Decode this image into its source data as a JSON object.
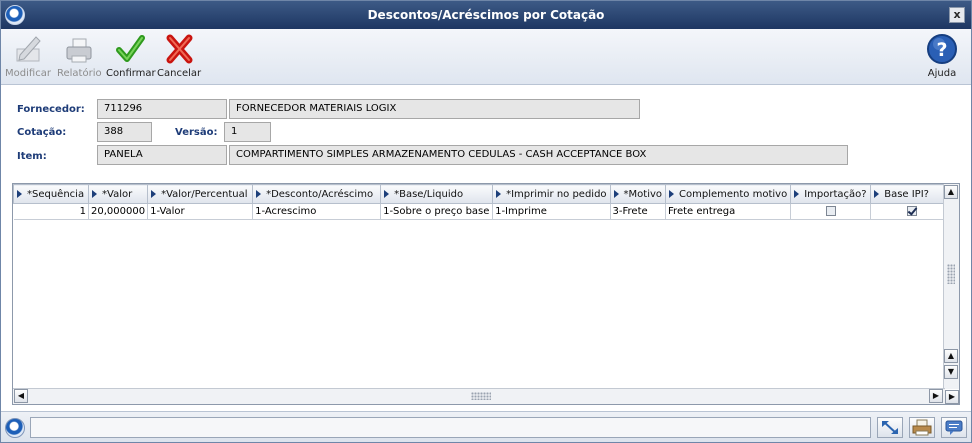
{
  "window": {
    "title": "Descontos/Acréscimos por Cotação",
    "close_label": "x"
  },
  "toolbar": {
    "buttons": [
      {
        "label": "Modificar",
        "icon": "edit-pencil-icon",
        "enabled": false
      },
      {
        "label": "Relatório",
        "icon": "printer-icon",
        "enabled": false
      },
      {
        "label": "Confirmar",
        "icon": "green-check-icon",
        "enabled": true
      },
      {
        "label": "Cancelar",
        "icon": "red-x-icon",
        "enabled": true
      }
    ],
    "help": {
      "label": "Ajuda",
      "icon": "help-question-icon"
    }
  },
  "form": {
    "fornecedor_label": "Fornecedor:",
    "fornecedor_code": "711296",
    "fornecedor_name": "FORNECEDOR MATERIAIS LOGIX",
    "cotacao_label": "Cotação:",
    "cotacao_value": "388",
    "versao_label": "Versão:",
    "versao_value": "1",
    "item_label": "Item:",
    "item_code": "PANELA",
    "item_desc": "COMPARTIMENTO SIMPLES ARMAZENAMENTO CEDULAS - CASH ACCEPTANCE BOX"
  },
  "grid": {
    "columns": [
      "*Sequência",
      "*Valor",
      "*Valor/Percentual",
      "*Desconto/Acréscimo",
      "*Base/Liquido",
      "*Imprimir no pedido",
      "*Motivo",
      "Complemento motivo",
      "Importação?",
      "Base IPI?"
    ],
    "rows": [
      {
        "sequencia": "1",
        "valor": "20,000000",
        "valor_percentual": "1-Valor",
        "desconto_acrescimo": "1-Acrescimo",
        "base_liquido": "1-Sobre o preço base",
        "imprimir": "1-Imprime",
        "motivo": "3-Frete",
        "complemento": "Frete entrega",
        "importacao": false,
        "base_ipi": true
      }
    ]
  },
  "colors": {
    "title_bar": "#1d3662",
    "label_text": "#1e3c78",
    "field_bg": "#e6e6e6"
  }
}
